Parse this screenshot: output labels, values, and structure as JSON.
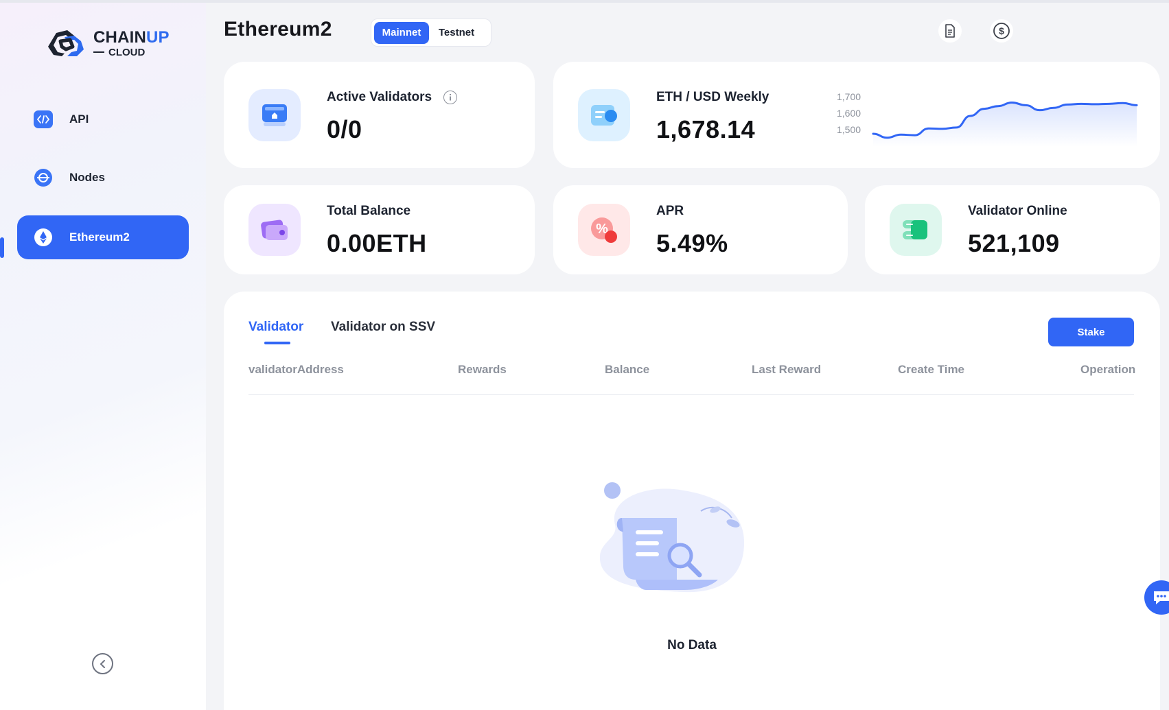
{
  "brand": {
    "name_main": "CHAIN",
    "name_accent": "UP",
    "name_sub": "CLOUD"
  },
  "sidebar": {
    "items": [
      {
        "label": "API",
        "icon": "code-icon"
      },
      {
        "label": "Nodes",
        "icon": "node-icon"
      },
      {
        "label": "Ethereum2",
        "icon": "ethereum-icon",
        "active": true
      }
    ]
  },
  "header": {
    "title": "Ethereum2",
    "network_options": [
      "Mainnet",
      "Testnet"
    ],
    "network_selected": "Mainnet"
  },
  "stats": {
    "active_validators": {
      "label": "Active Validators",
      "value": "0/0"
    },
    "eth_usd": {
      "label": "ETH / USD Weekly",
      "value": "1,678.14"
    },
    "total_balance": {
      "label": "Total Balance",
      "value": "0.00ETH"
    },
    "apr": {
      "label": "APR",
      "value": "5.49%"
    },
    "validator_online": {
      "label": "Validator Online",
      "value": "521,109"
    }
  },
  "chart_data": {
    "type": "area",
    "title": "",
    "xlabel": "",
    "ylabel": "",
    "y_ticks": [
      "1,700",
      "1,600",
      "1,500"
    ],
    "ylim": [
      1450,
      1750
    ],
    "x": [
      0,
      1,
      2,
      3,
      4,
      5,
      6,
      7,
      8,
      9,
      10,
      11,
      12,
      13,
      14,
      15,
      16,
      17,
      18,
      19
    ],
    "values": [
      1500,
      1478,
      1495,
      1492,
      1530,
      1528,
      1535,
      1600,
      1640,
      1655,
      1675,
      1660,
      1632,
      1645,
      1664,
      1668,
      1666,
      1668,
      1672,
      1660
    ],
    "color": "#3166f5"
  },
  "table": {
    "tabs": [
      "Validator",
      "Validator on SSV"
    ],
    "active_tab": "Validator",
    "stake_label": "Stake",
    "columns": [
      "validatorAddress",
      "Rewards",
      "Balance",
      "Last Reward",
      "Create Time",
      "Operation"
    ],
    "rows": [],
    "empty_text": "No Data"
  },
  "colors": {
    "accent": "#3166f5",
    "background": "#f3f4f7",
    "card": "#ffffff"
  }
}
